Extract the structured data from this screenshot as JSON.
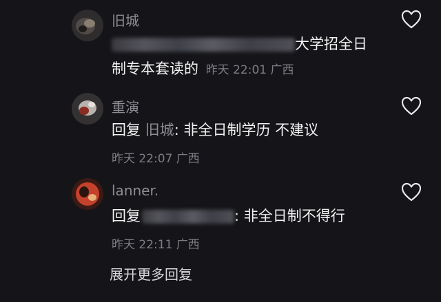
{
  "comments": [
    {
      "username": "旧城",
      "text_tail_line1": "大学招全日",
      "text_line2": "制专本套读的",
      "date": "昨天",
      "time": "22:01",
      "location": "广西"
    },
    {
      "username": "重演",
      "reply_prefix": "回复",
      "reply_target": "旧城",
      "reply_text": ": 非全日制学历 不建议",
      "date": "昨天",
      "time": "22:07",
      "location": "广西"
    },
    {
      "username": "lanner.",
      "reply_prefix": "回复",
      "reply_text": ": 非全日制不得行",
      "date": "昨天",
      "time": "22:11",
      "location": "广西"
    }
  ],
  "expand_label": "展开更多回复",
  "icons": {
    "like": "heart-outline-icon"
  },
  "colors": {
    "background": "#151519",
    "username": "#8d8d93",
    "body_text": "#f2f2f2",
    "meta_text": "#7d7d84"
  }
}
